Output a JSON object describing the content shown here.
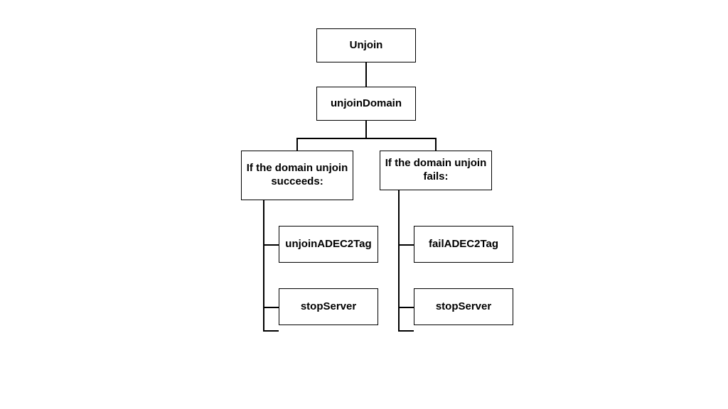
{
  "nodes": {
    "root": "Unjoin",
    "unjoinDomain": "unjoinDomain",
    "successBranch": "If the domain unjoin succeeds:",
    "failBranch": "If the domain unjoin fails:",
    "successStep1": "unjoinADEC2Tag",
    "successStep2": "stopServer",
    "failStep1": "failADEC2Tag",
    "failStep2": "stopServer"
  }
}
